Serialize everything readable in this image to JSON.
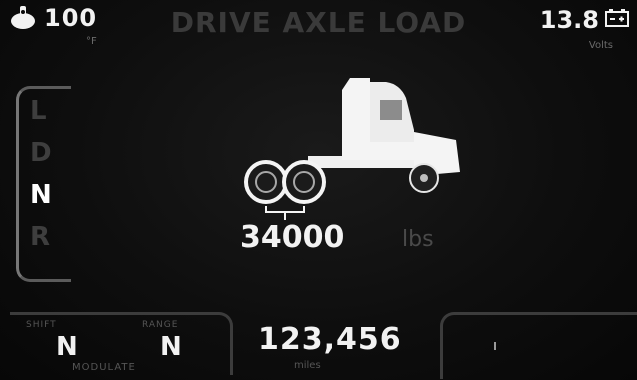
{
  "header": {
    "title": "DRIVE AXLE LOAD",
    "temperature": {
      "value": "100",
      "unit": "°F",
      "icon": "engine-temp-icon"
    },
    "voltage": {
      "value": "13.8",
      "unit": "Volts",
      "icon": "battery-icon"
    }
  },
  "gear_selector": {
    "items": [
      "L",
      "D",
      "N",
      "R"
    ],
    "active": "N"
  },
  "load": {
    "value": "34000",
    "unit": "lbs"
  },
  "bottom": {
    "modulate": {
      "label": "MODULATE",
      "left": {
        "caption": "SHIFT",
        "value": "N"
      },
      "right": {
        "caption": "RANGE",
        "value": "N"
      }
    },
    "odometer": {
      "value": "123,456",
      "unit": "miles"
    }
  },
  "colors": {
    "background": "#0b0b0b",
    "active_text": "#ffffff",
    "dim_text": "#3a3a3a"
  }
}
